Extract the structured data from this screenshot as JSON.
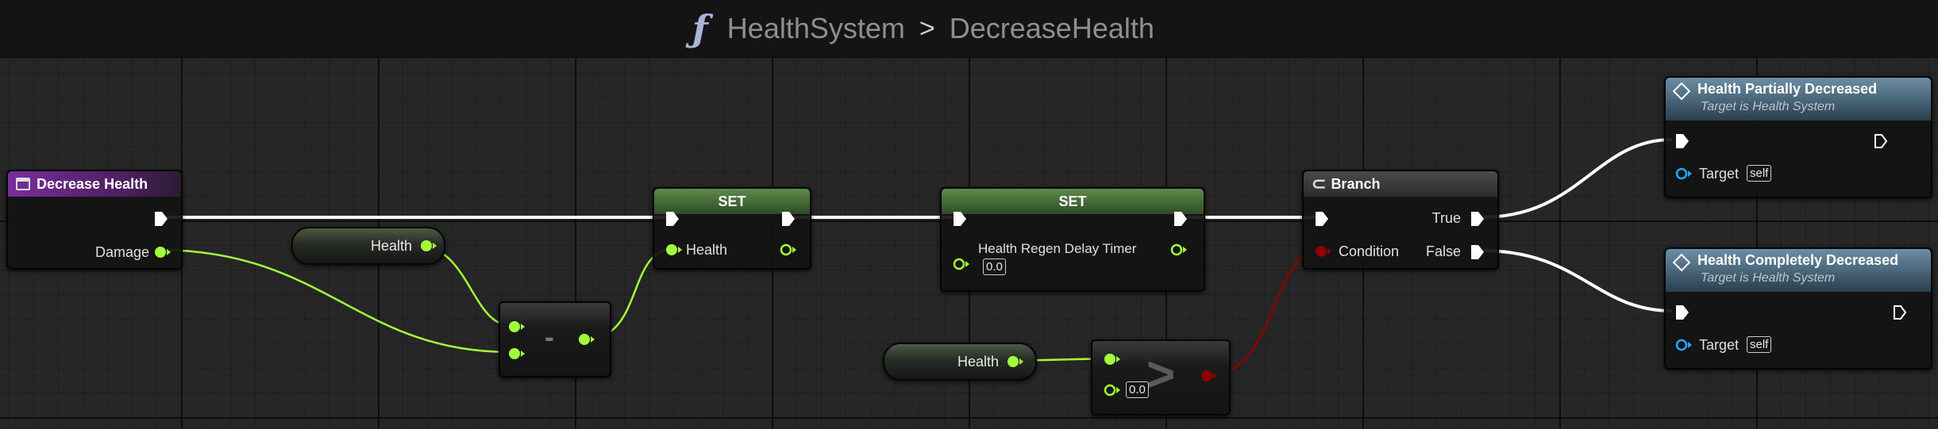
{
  "breadcrumb": {
    "function_icon": "ƒ",
    "graph_name": "HealthSystem",
    "separator": ">",
    "function_name": "DecreaseHealth"
  },
  "nodes": {
    "entry": {
      "title": "Decrease Health",
      "icon": "function-entry-icon",
      "pin_damage": "Damage"
    },
    "get_health_1": {
      "label": "Health"
    },
    "subtract": {
      "operator": "-"
    },
    "set_health": {
      "title": "SET",
      "pin_label": "Health"
    },
    "set_timer": {
      "title": "SET",
      "pin_label": "Health Regen Delay Timer",
      "value": "0.0"
    },
    "get_health_2": {
      "label": "Health"
    },
    "greater": {
      "operator": ">",
      "value": "0.0"
    },
    "branch": {
      "title": "Branch",
      "icon": "branch-icon",
      "pin_condition": "Condition",
      "pin_true": "True",
      "pin_false": "False"
    },
    "partial": {
      "title": "Health Partially Decreased",
      "subtitle": "Target is Health System",
      "pin_target": "Target",
      "target_value": "self",
      "icon": "event-diamond-icon"
    },
    "complete": {
      "title": "Health Completely Decreased",
      "subtitle": "Target is Health System",
      "pin_target": "Target",
      "target_value": "self",
      "icon": "event-diamond-icon"
    }
  },
  "colors": {
    "exec_wire": "#ffffff",
    "float_pin": "#a2ff3c",
    "bool_pin": "#8c0000",
    "object_pin": "#1fa9ff",
    "entry_header": "#6b2a8c",
    "set_header": "#4d7a3f",
    "branch_header": "#3b3b3b",
    "event_header": "#4c6f85"
  }
}
